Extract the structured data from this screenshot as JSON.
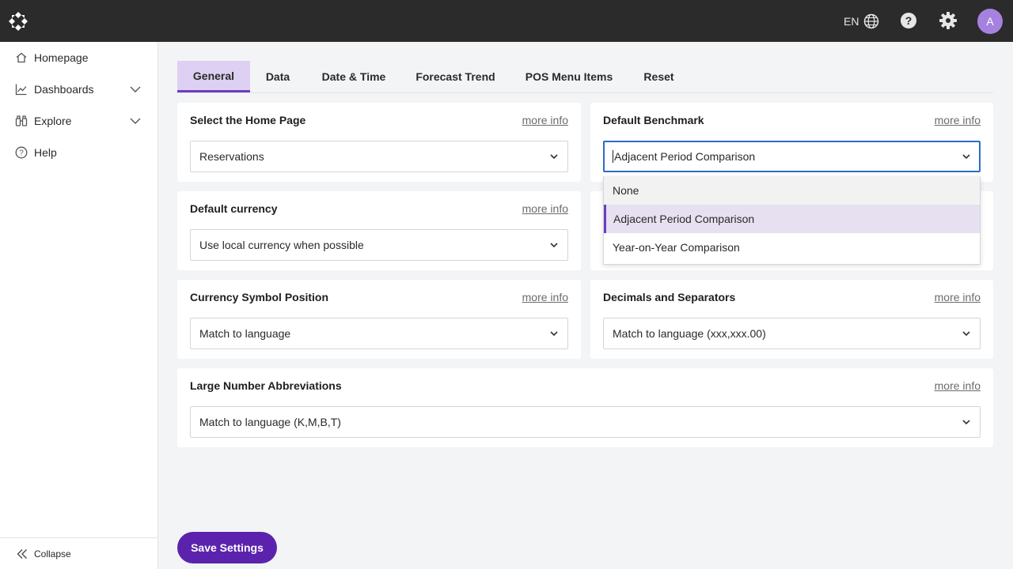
{
  "header": {
    "language": "EN",
    "avatar_initial": "A",
    "icons": [
      "logo-icon",
      "globe-icon",
      "help-icon",
      "gear-icon"
    ]
  },
  "sidebar": {
    "items": [
      {
        "label": "Homepage",
        "icon": "home-icon"
      },
      {
        "label": "Dashboards",
        "icon": "chart-line-icon",
        "expandable": true
      },
      {
        "label": "Explore",
        "icon": "binoculars-icon",
        "expandable": true
      },
      {
        "label": "Help",
        "icon": "question-circle-icon"
      }
    ],
    "collapse_label": "Collapse"
  },
  "tabs": [
    {
      "label": "General",
      "active": true
    },
    {
      "label": "Data"
    },
    {
      "label": "Date & Time"
    },
    {
      "label": "Forecast Trend"
    },
    {
      "label": "POS Menu Items"
    },
    {
      "label": "Reset"
    }
  ],
  "settings": {
    "more_info_label": "more info",
    "home_page": {
      "title": "Select the Home Page",
      "value": "Reservations"
    },
    "default_benchmark": {
      "title": "Default Benchmark",
      "value": "Adjacent Period Comparison",
      "options": [
        "None",
        "Adjacent Period Comparison",
        "Year-on-Year Comparison"
      ],
      "selected_index": 1
    },
    "default_currency": {
      "title": "Default currency",
      "value": "Use local currency when possible"
    },
    "currency_symbol_position": {
      "title": "Currency Symbol Position",
      "value": "Match to language"
    },
    "decimals_separators": {
      "title": "Decimals and Separators",
      "value": "Match to language (xxx,xxx.00)"
    },
    "large_number_abbreviations": {
      "title": "Large Number Abbreviations",
      "value": "Match to language (K,M,B,T)"
    }
  },
  "save_button_label": "Save Settings",
  "colors": {
    "topbar": "#2b2b2b",
    "accent": "#5b23ad",
    "tab_active_bg": "#ddd0f2",
    "focus_border": "#2c6cc4",
    "avatar": "#a682e0"
  }
}
